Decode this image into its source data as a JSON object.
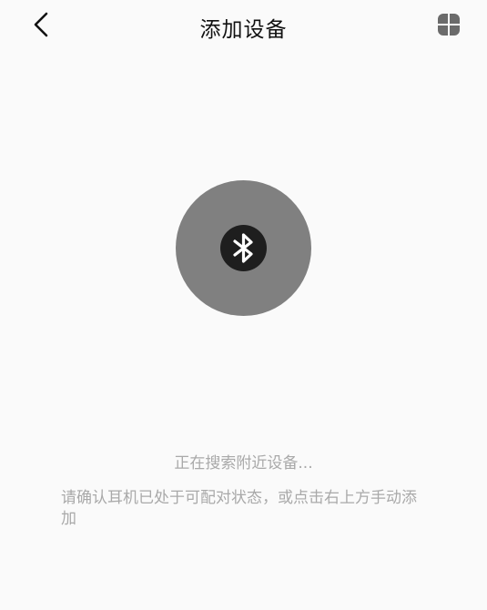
{
  "header": {
    "title": "添加设备",
    "back_icon": "chevron-left-icon",
    "apps_icon": "four-petal-grid-icon"
  },
  "scan": {
    "icon": "bluetooth-icon",
    "circle_color": "#808080",
    "badge_color": "#1e1e1e"
  },
  "status": {
    "searching": "正在搜索附近设备...",
    "hint": "请确认耳机已处于可配对状态，或点击右上方手动添加"
  }
}
